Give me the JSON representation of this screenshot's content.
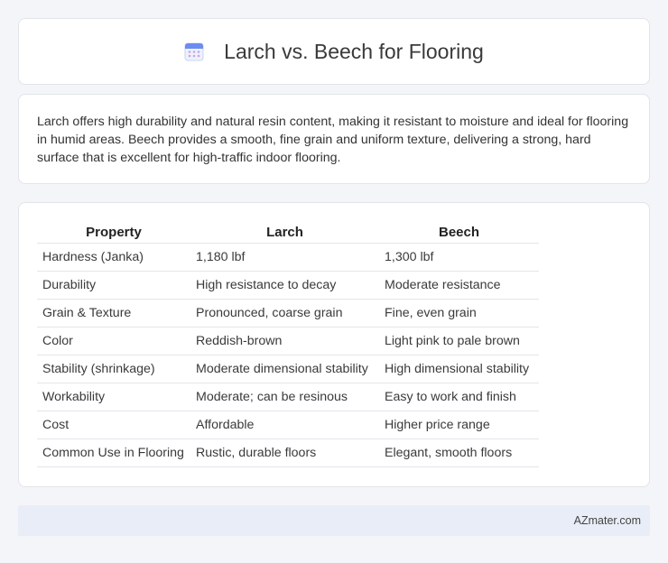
{
  "header": {
    "title": "Larch vs. Beech for Flooring",
    "icon": "calendar-icon",
    "icon_color": "#6b8cf0"
  },
  "intro": {
    "text": "Larch offers high durability and natural resin content, making it resistant to moisture and ideal for flooring in humid areas. Beech provides a smooth, fine grain and uniform texture, delivering a strong, hard surface that is excellent for high-traffic indoor flooring."
  },
  "table": {
    "headers": [
      "Property",
      "Larch",
      "Beech"
    ],
    "rows": [
      [
        "Hardness (Janka)",
        "1,180 lbf",
        "1,300 lbf"
      ],
      [
        "Durability",
        "High resistance to decay",
        "Moderate resistance"
      ],
      [
        "Grain & Texture",
        "Pronounced, coarse grain",
        "Fine, even grain"
      ],
      [
        "Color",
        "Reddish-brown",
        "Light pink to pale brown"
      ],
      [
        "Stability (shrinkage)",
        "Moderate dimensional stability",
        "High dimensional stability"
      ],
      [
        "Workability",
        "Moderate; can be resinous",
        "Easy to work and finish"
      ],
      [
        "Cost",
        "Affordable",
        "Higher price range"
      ],
      [
        "Common Use in Flooring",
        "Rustic, durable floors",
        "Elegant, smooth floors"
      ]
    ]
  },
  "footer": {
    "site": "AZmater.com"
  }
}
